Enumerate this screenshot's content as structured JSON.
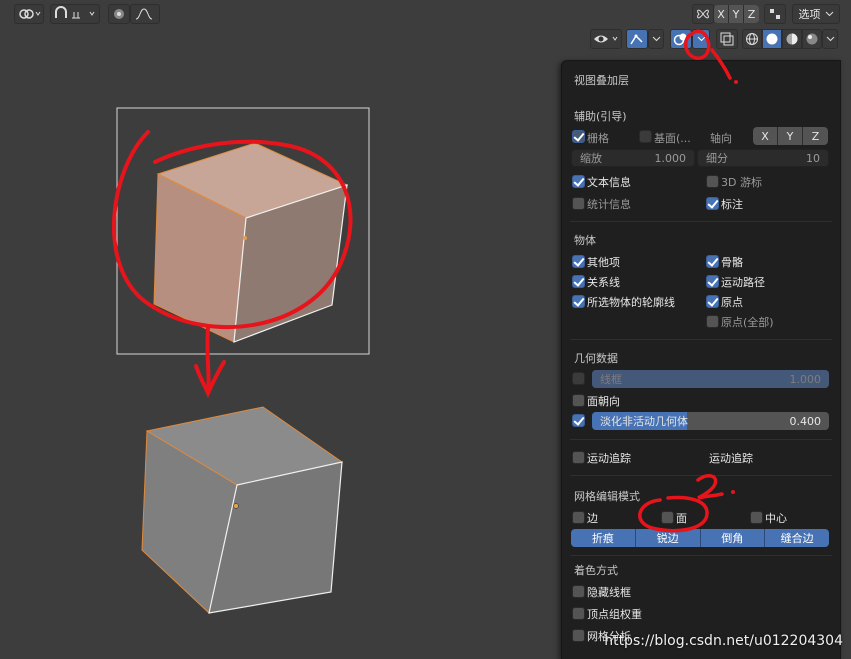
{
  "header": {
    "xyz": [
      "X",
      "Y",
      "Z"
    ],
    "options_label": "选项"
  },
  "overlay": {
    "title": "视图叠加层",
    "guides": {
      "section": "辅助(引导)",
      "grid": "栅格",
      "floor": "基面(...",
      "axis": "轴向",
      "axes": [
        "X",
        "Y",
        "Z"
      ],
      "scale_label": "缩放",
      "scale_value": "1.000",
      "subdiv_label": "细分",
      "subdiv_value": "10",
      "text_info": "文本信息",
      "cursor_3d": "3D 游标",
      "stats": "统计信息",
      "annotations": "标注"
    },
    "objects": {
      "section": "物体",
      "extras": "其他项",
      "bones": "骨骼",
      "relationships": "关系线",
      "motion_paths": "运动路径",
      "outline_selected": "所选物体的轮廓线",
      "origins": "原点",
      "origins_all": "原点(全部)"
    },
    "geometry": {
      "section": "几何数据",
      "wireframe": "线框",
      "wireframe_value": "1.000",
      "face_orientation": "面朝向",
      "fade_inactive": "淡化非活动几何体",
      "fade_value": "0.400",
      "fade_fraction": 0.4
    },
    "motion": {
      "motion_tracking": "运动追踪",
      "motion_tracking_2": "运动追踪"
    },
    "mesh_edit": {
      "section": "网格编辑模式",
      "edges": "边",
      "faces": "面",
      "center": "中心",
      "buttons": [
        "折痕",
        "锐边",
        "倒角",
        "缝合边"
      ]
    },
    "shading": {
      "section": "着色方式",
      "hidden_wire": "隐藏线框",
      "vertex_group_weights": "顶点组权重",
      "mesh_analysis": "网格分析"
    }
  },
  "annotations": {
    "mark_1": "1.",
    "mark_2": "2."
  },
  "watermark": "https://blog.csdn.net/u012204304"
}
